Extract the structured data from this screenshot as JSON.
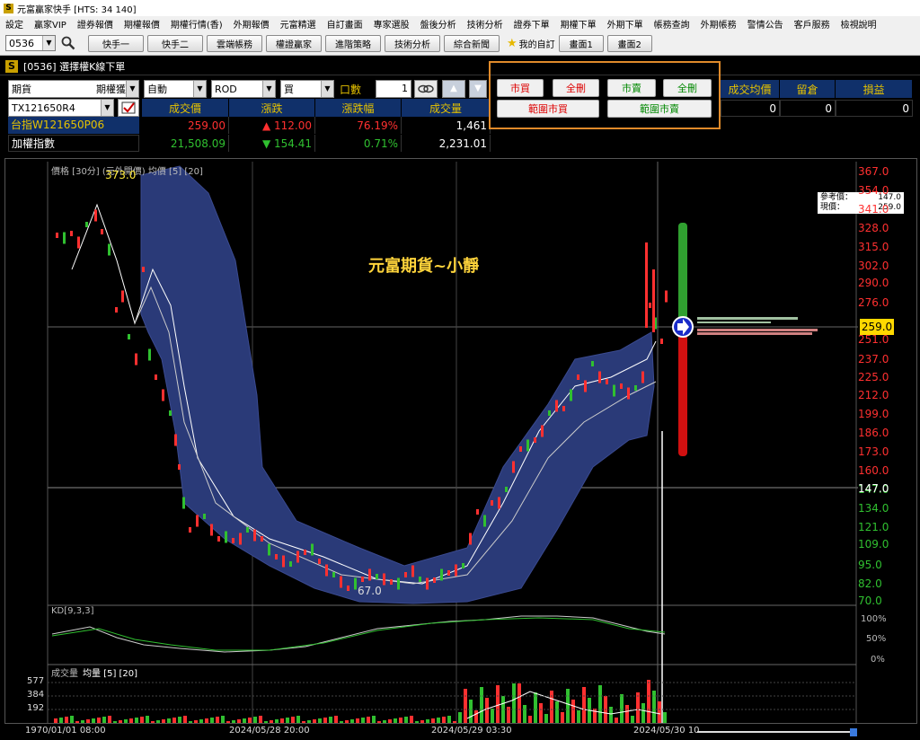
{
  "window": {
    "title": "元富贏家快手  [HTS: 34 140]"
  },
  "menu": [
    "設定",
    "贏家VIP",
    "證券報價",
    "期權報價",
    "期權行情(香)",
    "外期報價",
    "元富精選",
    "自訂畫面",
    "專家選股",
    "盤後分析",
    "技術分析",
    "證券下單",
    "期權下單",
    "外期下單",
    "帳務查詢",
    "外期帳務",
    "警情公告",
    "客戶服務",
    "檢視說明"
  ],
  "toolbar": {
    "code": "0536",
    "buttons": [
      "快手一",
      "快手二",
      "雲端帳務",
      "權證贏家",
      "進階策略",
      "技術分析",
      "綜合新聞"
    ],
    "favorite_label": "我的自訂",
    "screens": [
      "畫面1",
      "畫面2"
    ]
  },
  "window_sub": {
    "title": "[0536] 選擇權K線下單"
  },
  "order": {
    "product_type": "期貨",
    "product_type2": "期權獲",
    "mode": "自動",
    "condition": "ROD",
    "side": "買",
    "qty_label": "口數",
    "qty": "1",
    "contract": "TX121650R4",
    "btn_market_buy": "市買",
    "btn_del_all_1": "全刪",
    "btn_market_sell": "市賣",
    "btn_del_all_2": "全刪",
    "btn_range_buy": "範圍市買",
    "btn_range_sell": "範圍市賣"
  },
  "quote": {
    "headers": [
      "成交價",
      "漲跌",
      "漲跌幅",
      "成交量"
    ],
    "rows": [
      {
        "name": "台指W121650P06",
        "price": "259.00",
        "change": "▲ 112.00",
        "pct": "76.19%",
        "volume": "1,461"
      },
      {
        "name": "加權指數",
        "price": "21,508.09",
        "change": "▼ 154.41",
        "pct": "0.71%",
        "volume": "2,231.01"
      }
    ]
  },
  "position": {
    "headers": [
      "成交均價",
      "留倉",
      "損益"
    ],
    "values": [
      "0",
      "0",
      "0"
    ]
  },
  "chart": {
    "legend": "價格 [30分] (元外開價)  均價 [5] [20]",
    "high_label": "373.0",
    "low_label": "67.0",
    "watermark": "元富期貨~小靜",
    "ref_label": "參考價：",
    "ref_value": "147.0",
    "last_label": "現價：",
    "last_value": "259.0",
    "current_price": "259.0",
    "y_ticks": [
      "367.0",
      "354.0",
      "341.0",
      "328.0",
      "315.0",
      "302.0",
      "290.0",
      "276.0",
      "251.0",
      "237.0",
      "225.0",
      "212.0",
      "199.0",
      "186.0",
      "173.0",
      "160.0",
      "147.0",
      "134.0",
      "121.0",
      "109.0",
      "95.0",
      "82.0",
      "70.0"
    ],
    "kd_label": "KD[9,3,3]",
    "kd_ticks": [
      "100%",
      "50%",
      "0%"
    ],
    "vol_label": "成交量",
    "vol_avg": "均量 [5] [20]",
    "vol_ticks": [
      "577",
      "384",
      "192"
    ],
    "x_labels": [
      "1970/01/01 08:00",
      "2024/05/28 20:00",
      "2024/05/29 03:30",
      "2024/05/30 10"
    ]
  },
  "colors": {
    "up": "#ff3030",
    "down": "#30c030",
    "band": "#2a3a78",
    "header_bg": "#10306a",
    "header_fg": "#e6c200"
  }
}
